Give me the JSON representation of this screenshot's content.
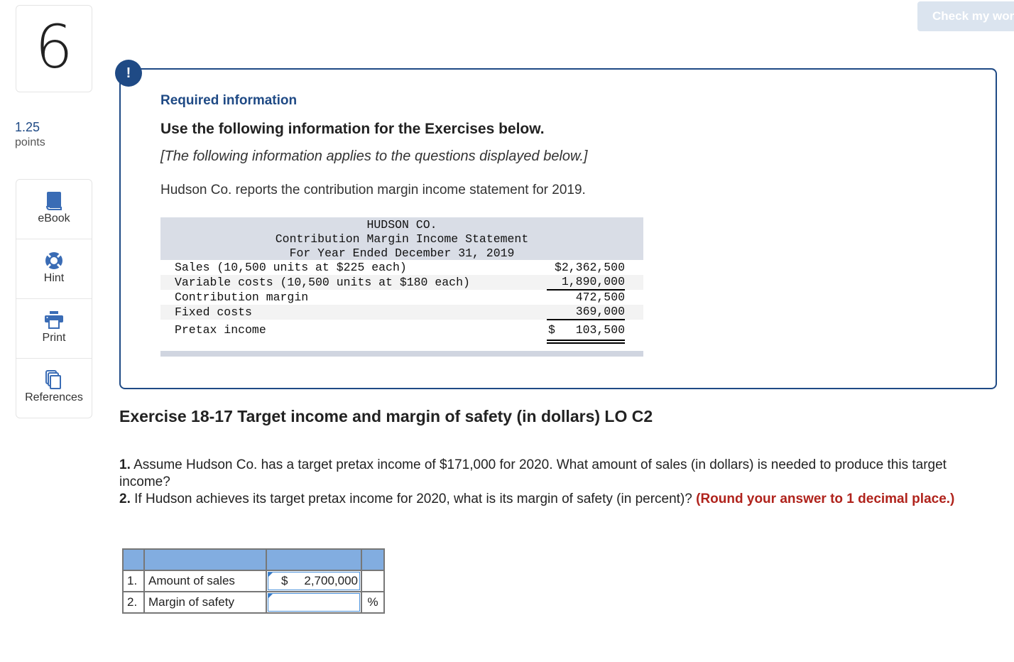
{
  "question": {
    "number": "6",
    "points_value": "1.25",
    "points_label": "points"
  },
  "tools": [
    {
      "icon": "book-icon",
      "label": "eBook"
    },
    {
      "icon": "lifebuoy-icon",
      "label": "Hint"
    },
    {
      "icon": "printer-icon",
      "label": "Print"
    },
    {
      "icon": "references-icon",
      "label": "References"
    }
  ],
  "header": {
    "check_button_label": "Check my work"
  },
  "info_box": {
    "alert_glyph": "!",
    "required_title": "Required information",
    "use_title": "Use the following information for the Exercises below.",
    "italic_note": "[The following information applies to the questions displayed below.]",
    "intro": "Hudson Co. reports the contribution margin income statement for 2019."
  },
  "statement": {
    "company": "HUDSON CO.",
    "title": "Contribution Margin Income Statement",
    "period": "For Year Ended December 31, 2019",
    "rows": [
      {
        "label": "Sales (10,500 units at $225 each)",
        "amount": "$2,362,500"
      },
      {
        "label": "Variable costs (10,500 units at $180 each)",
        "amount": "1,890,000"
      },
      {
        "label": "Contribution margin",
        "amount": "472,500"
      },
      {
        "label": "Fixed costs",
        "amount": "369,000"
      }
    ],
    "total": {
      "label": "Pretax income",
      "currency": "$",
      "amount": "103,500"
    }
  },
  "exercise": {
    "title": "Exercise 18-17 Target income and margin of safety (in dollars) LO C2",
    "q1_num": "1.",
    "q1_text": " Assume Hudson Co. has a target pretax income of $171,000 for 2020. What amount of sales (in dollars) is needed to produce this target income?",
    "q2_num": "2.",
    "q2_text": " If Hudson achieves its target pretax income for 2020, what is its margin of safety (in percent)? ",
    "q2_instruction": "(Round your answer to 1 decimal place.)"
  },
  "answer_table": {
    "rows": [
      {
        "num": "1.",
        "label": "Amount of sales",
        "currency": "$",
        "value": "2,700,000",
        "unit": ""
      },
      {
        "num": "2.",
        "label": "Margin of safety",
        "currency": "",
        "value": "",
        "unit": "%"
      }
    ]
  }
}
